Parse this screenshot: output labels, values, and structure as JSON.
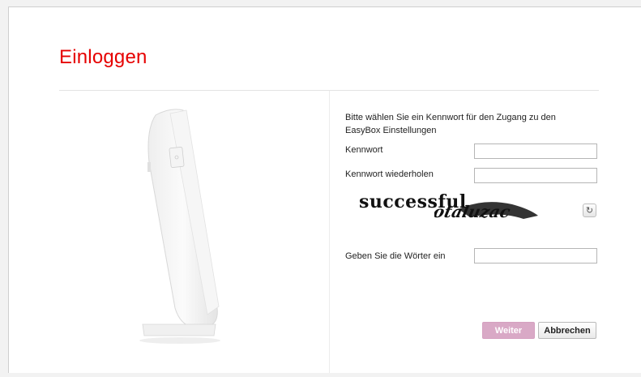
{
  "page": {
    "title": "Einloggen"
  },
  "form": {
    "intro": "Bitte wählen Sie ein Kennwort für den Zugang zu den EasyBox Einstellungen",
    "password_label": "Kennwort",
    "password_value": "",
    "password_repeat_label": "Kennwort wiederholen",
    "password_repeat_value": "",
    "captcha_words": [
      "successful",
      "otaluzac"
    ],
    "captcha_input_label": "Geben Sie die Wörter ein",
    "captcha_input_value": ""
  },
  "buttons": {
    "next": "Weiter",
    "cancel": "Abbrechen"
  },
  "icons": {
    "refresh": "refresh-icon"
  },
  "colors": {
    "title": "#e60000",
    "next_button": "#d9a9c6"
  }
}
